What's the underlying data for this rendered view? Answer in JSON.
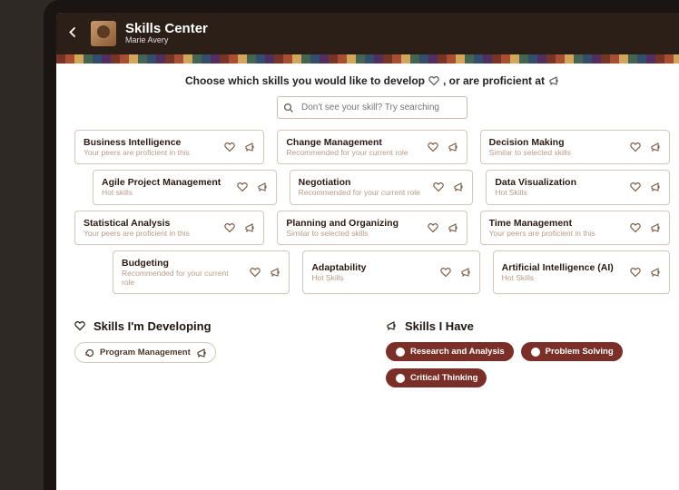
{
  "header": {
    "title": "Skills Center",
    "user": "Marie Avery"
  },
  "prompt": {
    "part1": "Choose which skills you would like to develop",
    "part2": ", or are proficient at"
  },
  "search": {
    "placeholder": "Don't see your skill? Try searching"
  },
  "skills": {
    "row1": [
      {
        "name": "Business Intelligence",
        "hint": "Your peers are proficient in this"
      },
      {
        "name": "Change Management",
        "hint": "Recommended for your current role"
      },
      {
        "name": "Decision Making",
        "hint": "Similar to selected skills"
      }
    ],
    "row2": [
      {
        "name": "Agile Project Management",
        "hint": "Hot skills"
      },
      {
        "name": "Negotiation",
        "hint": "Recommended for your current role"
      },
      {
        "name": "Data Visualization",
        "hint": "Hot Skills"
      }
    ],
    "row3": [
      {
        "name": "Statistical Analysis",
        "hint": "Your peers are proficient in this"
      },
      {
        "name": "Planning and Organizing",
        "hint": "Similar to selected skills"
      },
      {
        "name": "Time Management",
        "hint": "Your peers are proficient in this"
      }
    ],
    "row4": [
      {
        "name": "Budgeting",
        "hint": "Recommended for your current role"
      },
      {
        "name": "Adaptability",
        "hint": "Hot Skills"
      },
      {
        "name": "Artificial Intelligence (AI)",
        "hint": "Hot Skills"
      }
    ]
  },
  "sections": {
    "developing": {
      "title": "Skills I'm Developing",
      "chips": [
        {
          "label": "Program Management"
        }
      ]
    },
    "have": {
      "title": "Skills I Have",
      "chips": [
        {
          "label": "Research and Analysis"
        },
        {
          "label": "Problem Solving"
        },
        {
          "label": "Critical Thinking"
        }
      ]
    }
  },
  "icons": {
    "heart": "heart-icon",
    "megaphone": "megaphone-icon",
    "search": "search-icon",
    "back": "chevron-left-icon",
    "refresh": "refresh-icon",
    "info": "info-icon"
  }
}
